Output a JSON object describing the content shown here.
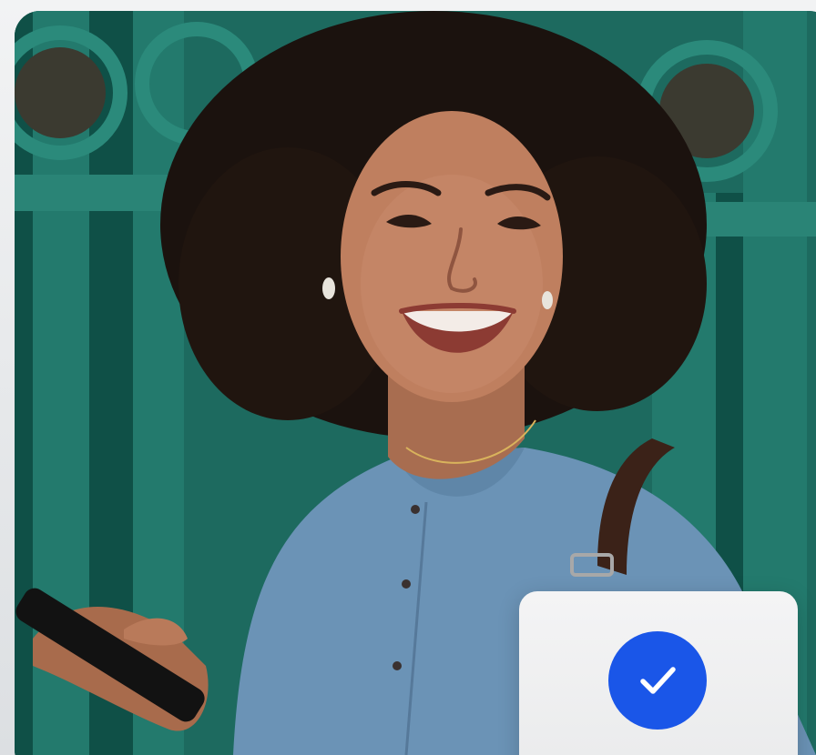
{
  "photo": {
    "description_icon": "portrait-photo",
    "palette": {
      "gate_teal": "#1f6b60",
      "gate_dark": "#0e4d44",
      "skin": "#b9795a",
      "hair": "#1c130f",
      "sweater": "#6d93b4",
      "strap": "#3a2218",
      "phone": "#111111"
    }
  },
  "verification_badge": {
    "icon": "checkmark-icon",
    "accent_color": "#1a56e8",
    "card_color": "#efeff0"
  }
}
